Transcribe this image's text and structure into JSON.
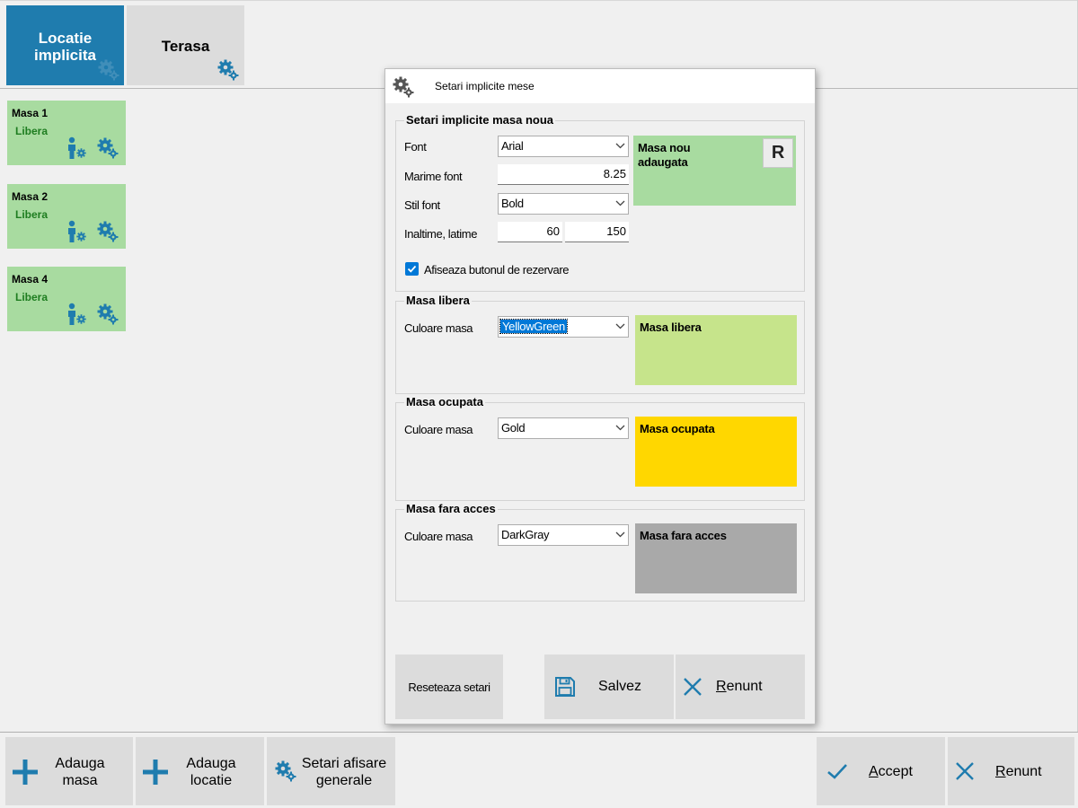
{
  "colors": {
    "accent": "#1f7cae",
    "tile_green": "#a8dba0",
    "status_green": "#1e7d20",
    "yellowgreen": "#c6e48b",
    "gold": "#ffd700",
    "darkgray": "#a9a9a9"
  },
  "tabs": [
    {
      "label_line1": "Locatie",
      "label_line2": "implicita",
      "icon": "gear-icon",
      "active": true
    },
    {
      "label": "Terasa",
      "icon": "gear-icon",
      "active": false
    }
  ],
  "tables": [
    {
      "name": "Masa 1",
      "status": "Libera"
    },
    {
      "name": "Masa 2",
      "status": "Libera"
    },
    {
      "name": "Masa 4",
      "status": "Libera"
    }
  ],
  "toolbar": {
    "add_table_line1": "Adauga",
    "add_table_line2": "masa",
    "add_location_line1": "Adauga",
    "add_location_line2": "locatie",
    "general_settings_line1": "Setari afisare",
    "general_settings_line2": "generale",
    "accept_mnemonic": "A",
    "accept_rest": "ccept",
    "cancel_mnemonic": "R",
    "cancel_rest": "enunt"
  },
  "dialog": {
    "title": "Setari implicite mese",
    "new_table": {
      "group_title": "Setari implicite masa noua",
      "font_label": "Font",
      "font_value": "Arial",
      "font_size_label": "Marime font",
      "font_size_value": "8.25",
      "font_style_label": "Stil font",
      "font_style_value": "Bold",
      "height_width_label": "Inaltime, latime",
      "height_value": "60",
      "width_value": "150",
      "show_reservation_label": "Afiseaza butonul de rezervare",
      "show_reservation_checked": true,
      "preview_line1": "Masa nou",
      "preview_line2": "adaugata",
      "reservation_badge": "R"
    },
    "free_table": {
      "group_title": "Masa libera",
      "color_label": "Culoare masa",
      "color_value": "YellowGreen",
      "preview": "Masa libera"
    },
    "occupied_table": {
      "group_title": "Masa ocupata",
      "color_label": "Culoare masa",
      "color_value": "Gold",
      "preview": "Masa ocupata"
    },
    "no_access_table": {
      "group_title": "Masa fara acces",
      "color_label": "Culoare masa",
      "color_value": "DarkGray",
      "preview": "Masa fara acces"
    },
    "reset_label": "Reseteaza setari",
    "save_label": "Salvez",
    "cancel_mnemonic": "R",
    "cancel_rest": "enunt"
  }
}
